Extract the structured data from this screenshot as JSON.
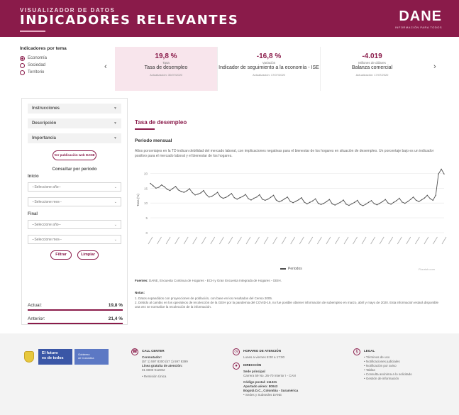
{
  "header": {
    "subtitle": "VISUALIZADOR DE DATOS",
    "title": "INDICADORES RELEVANTES",
    "logo": "DANE",
    "logo_tagline": "INFORMACIÓN PARA TODOS"
  },
  "themes": {
    "title": "Indicadores por tema",
    "options": [
      {
        "label": "Economía",
        "selected": true
      },
      {
        "label": "Sociedad",
        "selected": false
      },
      {
        "label": "Territorio",
        "selected": false
      }
    ]
  },
  "cards": [
    {
      "value": "19,8 %",
      "unit": "Tasa",
      "name": "Tasa de desempleo",
      "date": "Actualización: 30/07/2020",
      "active": true
    },
    {
      "value": "-16,8 %",
      "unit": "Variación",
      "name": "Indicador de seguimiento a la economía - ISE",
      "date": "Actualización: 17/07/2020",
      "active": false
    },
    {
      "value": "-4.019",
      "unit": "Millones de dólares",
      "name": "Balanza comercial",
      "date": "Actualización: 17/07/2020",
      "active": false
    }
  ],
  "nav": {
    "prev": "‹",
    "next": "›"
  },
  "panel": {
    "accordions": [
      "Instrucciones",
      "Descripción",
      "Importancia"
    ],
    "pill": "Ver publicación web DANE",
    "consult_title": "Consultar por periodo",
    "start_label": "Inicio",
    "end_label": "Final",
    "year_placeholder": "--Seleccione año--",
    "month_placeholder": "--Seleccione mes--",
    "filter_button": "Filtrar",
    "clear_button": "Limpiar",
    "current_label": "Actual:",
    "current_value": "19,8 %",
    "previous_label": "Anterior:",
    "previous_value": "21,4 %"
  },
  "content": {
    "title": "Tasa de desempleo",
    "subtitle": "Periodo mensual",
    "description": "Altos porcentajes en la TD indican debilidad del mercado laboral, con implicaciones negativas para el bienestar de los hogares en situación de desempleo. Un porcentaje bajo es un indicador positivo para el mercado laboral y el bienestar de los hogares.",
    "legend": "Periodos",
    "credit": "Flourish.com",
    "source_label": "Fuentes:",
    "source_text": "DANE, Encuesta Continua de Hogares - ECH y Gran Encuesta Integrada de Hogares - GEIH.",
    "notes_title": "Notas:",
    "notes": [
      "1. Datos expandidos con proyecciones de población, con base en los resultados del Censo 2005.",
      "2. Debido al cambio en los operativos de recolección de la GEIH por la pandemia del COVID-19, no fue posible obtener información de subempleo en marzo, abril y mayo de 2020. Esta información estará disponible una vez se normalice la recolección de la información."
    ]
  },
  "chart_data": {
    "type": "line",
    "ylabel": "Tasa (%)",
    "yticks": [
      "20",
      "15",
      "10",
      "5",
      "0"
    ],
    "ylim": [
      0,
      22
    ],
    "xlabel": "Periodos",
    "x_start": "2001",
    "x_end": "2020",
    "grid": true,
    "series": [
      {
        "values": [
          16.6,
          15.8,
          15.0,
          15.3,
          16.1,
          15.5,
          14.6,
          14.2,
          14.9,
          15.6,
          14.4,
          13.9,
          13.6,
          14.1,
          14.8,
          13.5,
          12.7,
          13.0,
          13.4,
          14.2,
          12.8,
          12.0,
          12.3,
          12.9,
          13.6,
          12.1,
          11.6,
          11.9,
          12.5,
          13.2,
          11.8,
          11.3,
          11.8,
          12.2,
          12.9,
          11.5,
          11.0,
          11.6,
          12.0,
          12.8,
          11.3,
          10.9,
          11.3,
          11.9,
          12.6,
          11.0,
          10.4,
          10.8,
          11.4,
          12.0,
          10.6,
          10.1,
          10.6,
          11.1,
          11.8,
          10.3,
          9.7,
          10.2,
          10.7,
          11.4,
          9.9,
          9.5,
          9.9,
          10.5,
          11.2,
          9.7,
          9.3,
          9.8,
          10.3,
          11.0,
          9.6,
          9.2,
          9.7,
          10.2,
          10.9,
          9.5,
          9.1,
          9.6,
          10.2,
          10.8,
          9.8,
          9.4,
          9.9,
          10.5,
          11.2,
          10.0,
          9.6,
          10.2,
          10.8,
          11.6,
          10.3,
          9.9,
          10.5,
          11.2,
          12.0,
          10.9,
          10.5,
          11.1,
          11.7,
          12.6,
          11.5,
          10.9,
          12.6,
          19.8,
          21.4,
          19.8
        ]
      }
    ]
  },
  "footer": {
    "brand_line1": "El futuro",
    "brand_line2": "es de todos",
    "gov_line1": "Gobierno",
    "gov_line2": "de Colombia",
    "call_title": "CALL CENTER",
    "call_l1": "Conmutador:",
    "call_l2": "(57 1) 597 8300 (57 1) 597 8399",
    "call_l3": "Línea gratuita de atención:",
    "call_l4": "01 8000 912002",
    "call_l5": "• Remisión Única",
    "hours_title": "HORARIO DE ATENCIÓN",
    "hours_l1": "Lunes a viernes 8:00 a 17:00",
    "addr_title": "DIRECCIÓN",
    "addr_l1": "Sede principal",
    "addr_l2": "Carrera 59 No. 26-70 Interior I - CAN",
    "addr_l3": "Código postal: 111321",
    "addr_l4": "Apartado aéreo: 80043",
    "addr_l5": "Bogotá D.C., Colombia - Suramérica",
    "addr_l6": "• Sedes y Subsedes DANE",
    "legal_title": "LEGAL",
    "legal_items": [
      "• Términos de uso",
      "• Notificaciones judiciales",
      "• Notificación por aviso",
      "• Tablas",
      "• Consulta anónima a lo solicitado",
      "• Gestión de información"
    ]
  },
  "colors": {
    "brand": "#8a1b4a",
    "line": "#4f4f4f",
    "grid": "#e6e6e6"
  },
  "icons": [
    "phone-icon",
    "clock-icon",
    "location-icon",
    "legal-icon",
    "radio-icon",
    "chevron-down-icon",
    "chevron-left-icon",
    "chevron-right-icon"
  ]
}
